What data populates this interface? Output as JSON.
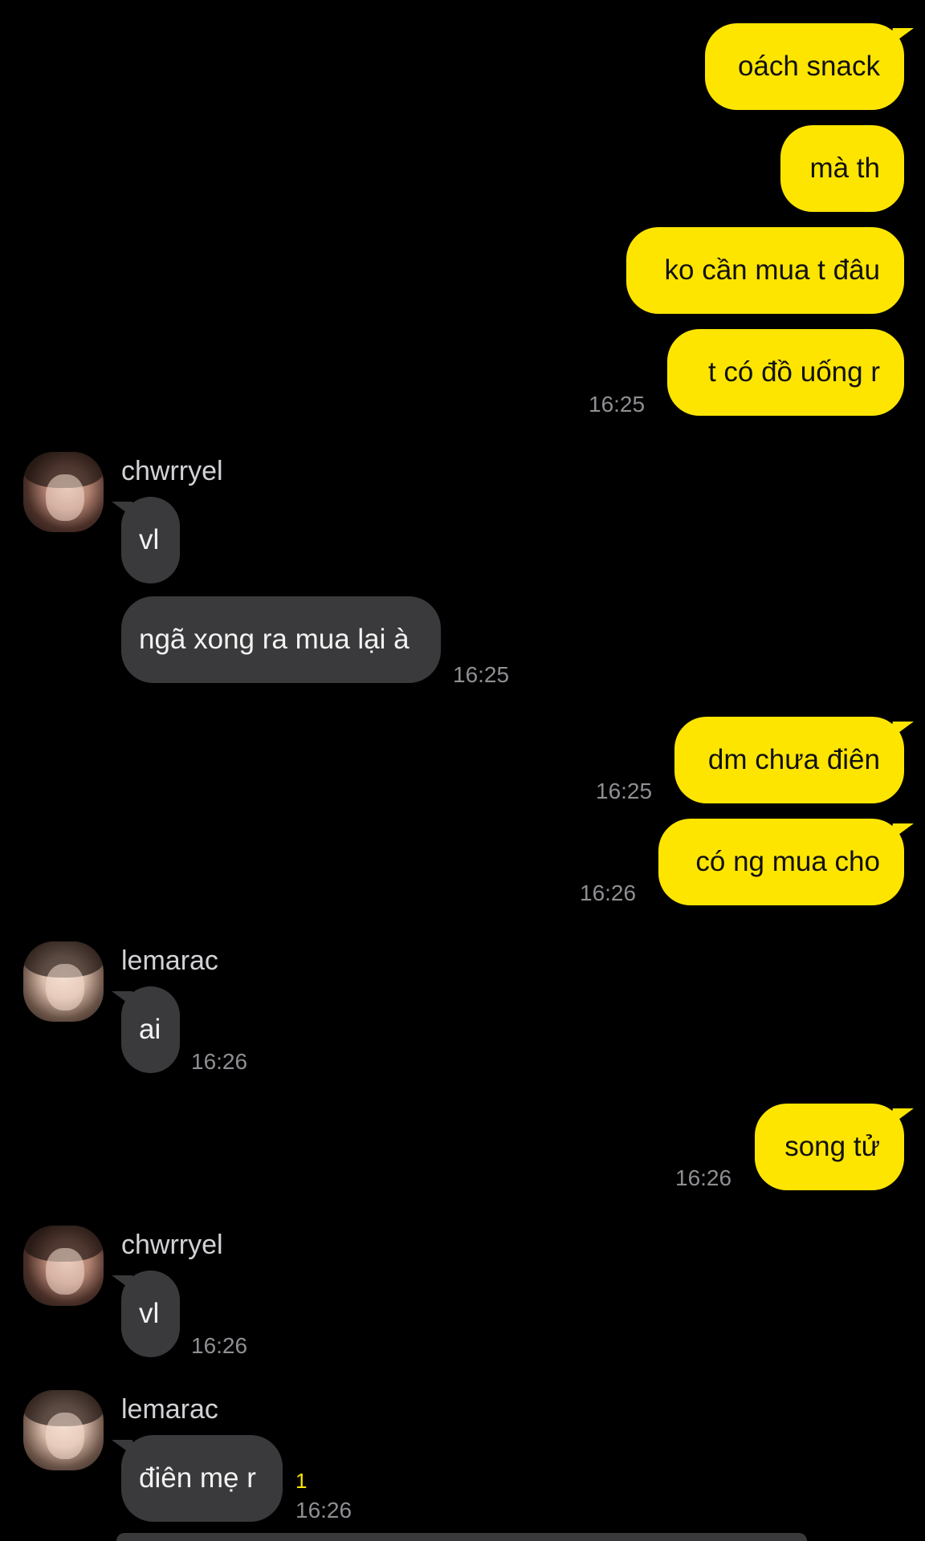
{
  "outgoing": [
    {
      "id": "m1",
      "text": "oách snack",
      "time": ""
    },
    {
      "id": "m2",
      "text": "mà th",
      "time": ""
    },
    {
      "id": "m3",
      "text": "ko cần mua t đâu",
      "time": ""
    },
    {
      "id": "m4",
      "text": "t có đồ uống r",
      "time": "16:25"
    },
    {
      "id": "m5",
      "text": "dm chưa điên",
      "time": "16:25"
    },
    {
      "id": "m6",
      "text": "có ng mua cho",
      "time": "16:26"
    },
    {
      "id": "m7",
      "text": "song tử",
      "time": "16:26"
    }
  ],
  "incoming": [
    {
      "sender": "chwrryel",
      "messages": [
        {
          "text": "vl",
          "time": ""
        },
        {
          "text": "ngã xong ra mua lại à",
          "time": "16:25"
        }
      ]
    },
    {
      "sender": "lemarac",
      "messages": [
        {
          "text": "ai",
          "time": "16:26"
        }
      ]
    },
    {
      "sender": "chwrryel",
      "messages": [
        {
          "text": "vl",
          "time": "16:26"
        }
      ]
    },
    {
      "sender": "lemarac",
      "messages": [
        {
          "text": "điên mẹ r",
          "time": "16:26",
          "unread": "1"
        }
      ]
    }
  ],
  "icons": {
    "avatar_chwrryel": "avatar-photo-icon",
    "avatar_lemarac": "avatar-photo-icon"
  },
  "colors": {
    "background": "#000000",
    "outgoing_bubble": "#FEE500",
    "incoming_bubble": "#3A3A3C",
    "timestamp": "#8E8E93",
    "unread": "#FEE500"
  }
}
